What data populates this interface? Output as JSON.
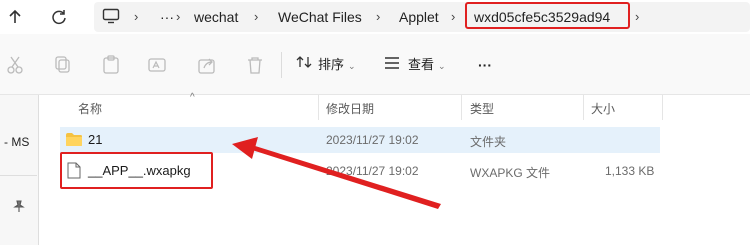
{
  "address_bar": {
    "breadcrumbs": [
      "wechat",
      "WeChat Files",
      "Applet",
      "wxd05cfe5c3529ad94"
    ],
    "ellipsis": "···"
  },
  "toolbar": {
    "sort_label": "排序",
    "view_label": "查看",
    "more_label": "···"
  },
  "sidebar": {
    "clipped_text": "- MS"
  },
  "columns": [
    "名称",
    "修改日期",
    "类型",
    "大小"
  ],
  "files": [
    {
      "name": "21",
      "modified": "2023/11/27 19:02",
      "type": "文件夹",
      "size": "",
      "icon": "folder-icon"
    },
    {
      "name": "__APP__.wxapkg",
      "modified": "2023/11/27 19:02",
      "type": "WXAPKG 文件",
      "size": "1,133 KB",
      "icon": "file-icon"
    }
  ],
  "annotations": {
    "highlight_color": "#e02020",
    "selection_color": "#e5f1fb"
  }
}
